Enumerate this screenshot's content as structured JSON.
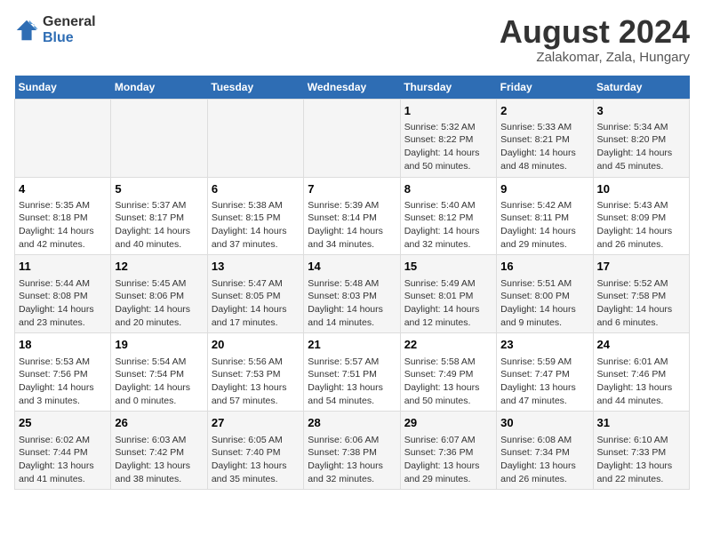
{
  "logo": {
    "general": "General",
    "blue": "Blue"
  },
  "title": "August 2024",
  "subtitle": "Zalakomar, Zala, Hungary",
  "days_of_week": [
    "Sunday",
    "Monday",
    "Tuesday",
    "Wednesday",
    "Thursday",
    "Friday",
    "Saturday"
  ],
  "weeks": [
    [
      {
        "day": "",
        "info": ""
      },
      {
        "day": "",
        "info": ""
      },
      {
        "day": "",
        "info": ""
      },
      {
        "day": "",
        "info": ""
      },
      {
        "day": "1",
        "info": "Sunrise: 5:32 AM\nSunset: 8:22 PM\nDaylight: 14 hours and 50 minutes."
      },
      {
        "day": "2",
        "info": "Sunrise: 5:33 AM\nSunset: 8:21 PM\nDaylight: 14 hours and 48 minutes."
      },
      {
        "day": "3",
        "info": "Sunrise: 5:34 AM\nSunset: 8:20 PM\nDaylight: 14 hours and 45 minutes."
      }
    ],
    [
      {
        "day": "4",
        "info": "Sunrise: 5:35 AM\nSunset: 8:18 PM\nDaylight: 14 hours and 42 minutes."
      },
      {
        "day": "5",
        "info": "Sunrise: 5:37 AM\nSunset: 8:17 PM\nDaylight: 14 hours and 40 minutes."
      },
      {
        "day": "6",
        "info": "Sunrise: 5:38 AM\nSunset: 8:15 PM\nDaylight: 14 hours and 37 minutes."
      },
      {
        "day": "7",
        "info": "Sunrise: 5:39 AM\nSunset: 8:14 PM\nDaylight: 14 hours and 34 minutes."
      },
      {
        "day": "8",
        "info": "Sunrise: 5:40 AM\nSunset: 8:12 PM\nDaylight: 14 hours and 32 minutes."
      },
      {
        "day": "9",
        "info": "Sunrise: 5:42 AM\nSunset: 8:11 PM\nDaylight: 14 hours and 29 minutes."
      },
      {
        "day": "10",
        "info": "Sunrise: 5:43 AM\nSunset: 8:09 PM\nDaylight: 14 hours and 26 minutes."
      }
    ],
    [
      {
        "day": "11",
        "info": "Sunrise: 5:44 AM\nSunset: 8:08 PM\nDaylight: 14 hours and 23 minutes."
      },
      {
        "day": "12",
        "info": "Sunrise: 5:45 AM\nSunset: 8:06 PM\nDaylight: 14 hours and 20 minutes."
      },
      {
        "day": "13",
        "info": "Sunrise: 5:47 AM\nSunset: 8:05 PM\nDaylight: 14 hours and 17 minutes."
      },
      {
        "day": "14",
        "info": "Sunrise: 5:48 AM\nSunset: 8:03 PM\nDaylight: 14 hours and 14 minutes."
      },
      {
        "day": "15",
        "info": "Sunrise: 5:49 AM\nSunset: 8:01 PM\nDaylight: 14 hours and 12 minutes."
      },
      {
        "day": "16",
        "info": "Sunrise: 5:51 AM\nSunset: 8:00 PM\nDaylight: 14 hours and 9 minutes."
      },
      {
        "day": "17",
        "info": "Sunrise: 5:52 AM\nSunset: 7:58 PM\nDaylight: 14 hours and 6 minutes."
      }
    ],
    [
      {
        "day": "18",
        "info": "Sunrise: 5:53 AM\nSunset: 7:56 PM\nDaylight: 14 hours and 3 minutes."
      },
      {
        "day": "19",
        "info": "Sunrise: 5:54 AM\nSunset: 7:54 PM\nDaylight: 14 hours and 0 minutes."
      },
      {
        "day": "20",
        "info": "Sunrise: 5:56 AM\nSunset: 7:53 PM\nDaylight: 13 hours and 57 minutes."
      },
      {
        "day": "21",
        "info": "Sunrise: 5:57 AM\nSunset: 7:51 PM\nDaylight: 13 hours and 54 minutes."
      },
      {
        "day": "22",
        "info": "Sunrise: 5:58 AM\nSunset: 7:49 PM\nDaylight: 13 hours and 50 minutes."
      },
      {
        "day": "23",
        "info": "Sunrise: 5:59 AM\nSunset: 7:47 PM\nDaylight: 13 hours and 47 minutes."
      },
      {
        "day": "24",
        "info": "Sunrise: 6:01 AM\nSunset: 7:46 PM\nDaylight: 13 hours and 44 minutes."
      }
    ],
    [
      {
        "day": "25",
        "info": "Sunrise: 6:02 AM\nSunset: 7:44 PM\nDaylight: 13 hours and 41 minutes."
      },
      {
        "day": "26",
        "info": "Sunrise: 6:03 AM\nSunset: 7:42 PM\nDaylight: 13 hours and 38 minutes."
      },
      {
        "day": "27",
        "info": "Sunrise: 6:05 AM\nSunset: 7:40 PM\nDaylight: 13 hours and 35 minutes."
      },
      {
        "day": "28",
        "info": "Sunrise: 6:06 AM\nSunset: 7:38 PM\nDaylight: 13 hours and 32 minutes."
      },
      {
        "day": "29",
        "info": "Sunrise: 6:07 AM\nSunset: 7:36 PM\nDaylight: 13 hours and 29 minutes."
      },
      {
        "day": "30",
        "info": "Sunrise: 6:08 AM\nSunset: 7:34 PM\nDaylight: 13 hours and 26 minutes."
      },
      {
        "day": "31",
        "info": "Sunrise: 6:10 AM\nSunset: 7:33 PM\nDaylight: 13 hours and 22 minutes."
      }
    ]
  ]
}
